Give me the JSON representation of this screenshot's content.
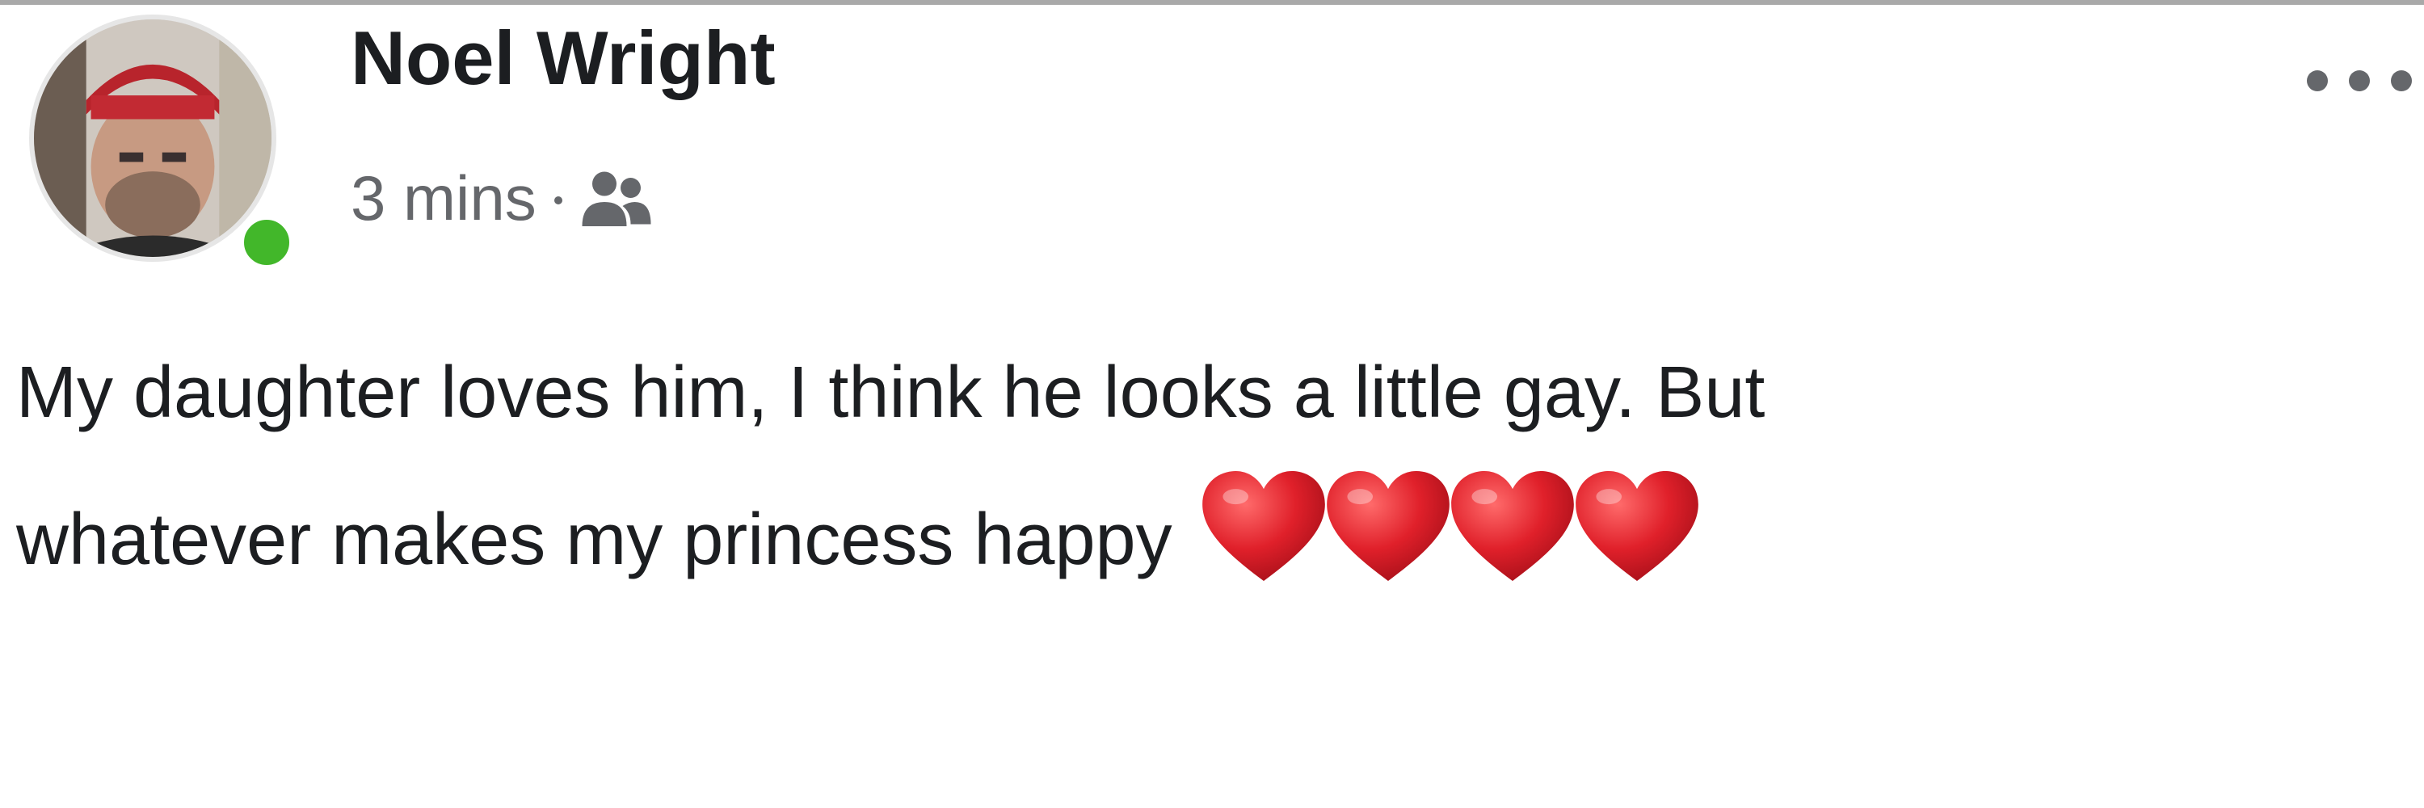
{
  "post": {
    "author_name": "Noel Wright",
    "timestamp": "3 mins",
    "separator": "·",
    "audience_icon": "friends-icon",
    "more_icon": "more-options-icon",
    "online_status_icon": "online-dot",
    "text_line_1": "My daughter loves him, I think he looks a little gay. But",
    "text_line_2": "whatever makes my princess happy",
    "emoji": [
      "red-heart",
      "red-heart",
      "red-heart",
      "red-heart"
    ]
  },
  "colors": {
    "online": "#42b72a",
    "meta_text": "#65676b",
    "heart": "#e0202a"
  }
}
